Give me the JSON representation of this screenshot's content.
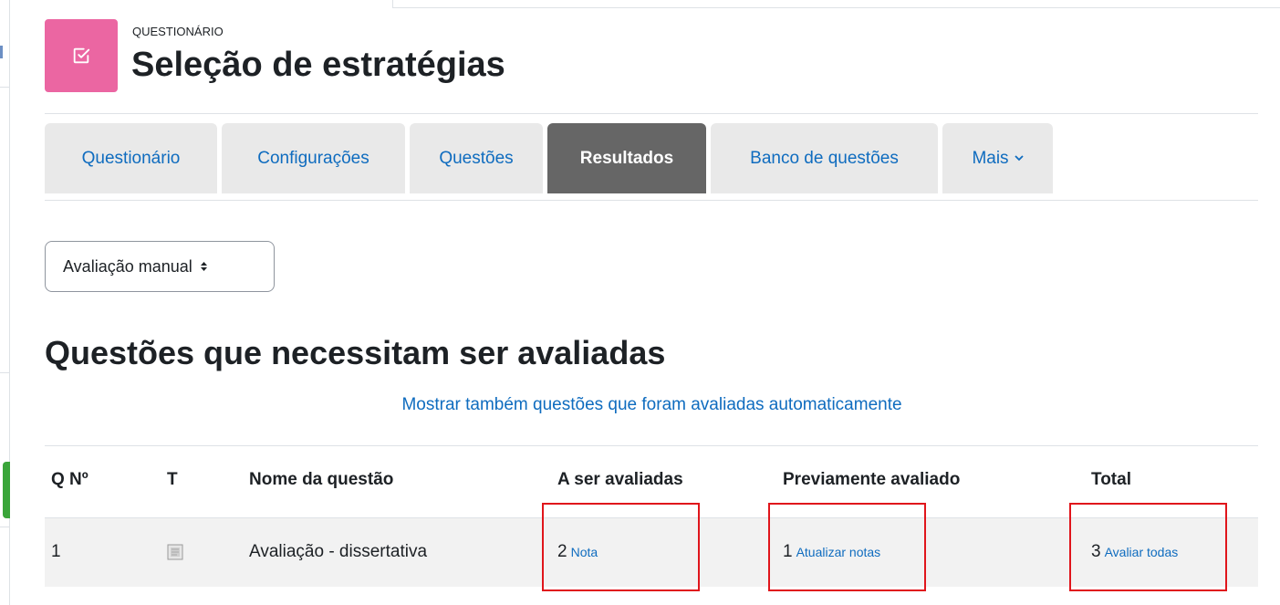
{
  "header": {
    "pretitle": "QUESTIONÁRIO",
    "title": "Seleção de estratégias",
    "icon": "quiz-checkbox-icon",
    "icon_color": "#eb66a2"
  },
  "tabs": [
    {
      "label": "Questionário",
      "active": false
    },
    {
      "label": "Configurações",
      "active": false
    },
    {
      "label": "Questões",
      "active": false
    },
    {
      "label": "Resultados",
      "active": true
    },
    {
      "label": "Banco de questões",
      "active": false
    },
    {
      "label": "Mais",
      "active": false,
      "icon": "chevron-down-icon"
    }
  ],
  "report_select": {
    "value": "Avaliação manual",
    "icon": "updown-caret-icon"
  },
  "section": {
    "heading": "Questões que necessitam ser avaliadas",
    "toggle_link": "Mostrar também questões que foram avaliadas automaticamente"
  },
  "table": {
    "headers": [
      "Q Nº",
      "T",
      "Nome da questão",
      "A ser avaliadas",
      "Previamente avaliado",
      "Total"
    ],
    "rows": [
      {
        "qno": "1",
        "type_icon": "essay-question-icon",
        "name": "Avaliação - dissertativa",
        "to_grade_count": "2",
        "to_grade_link": "Nota",
        "already_graded_count": "1",
        "already_graded_link": "Atualizar notas",
        "total_count": "3",
        "total_link": "Avaliar todas"
      }
    ]
  },
  "colors": {
    "link": "#0f6cbf",
    "active_tab": "#666666",
    "tab": "#e9e9e9",
    "highlight": "#e0151b"
  }
}
